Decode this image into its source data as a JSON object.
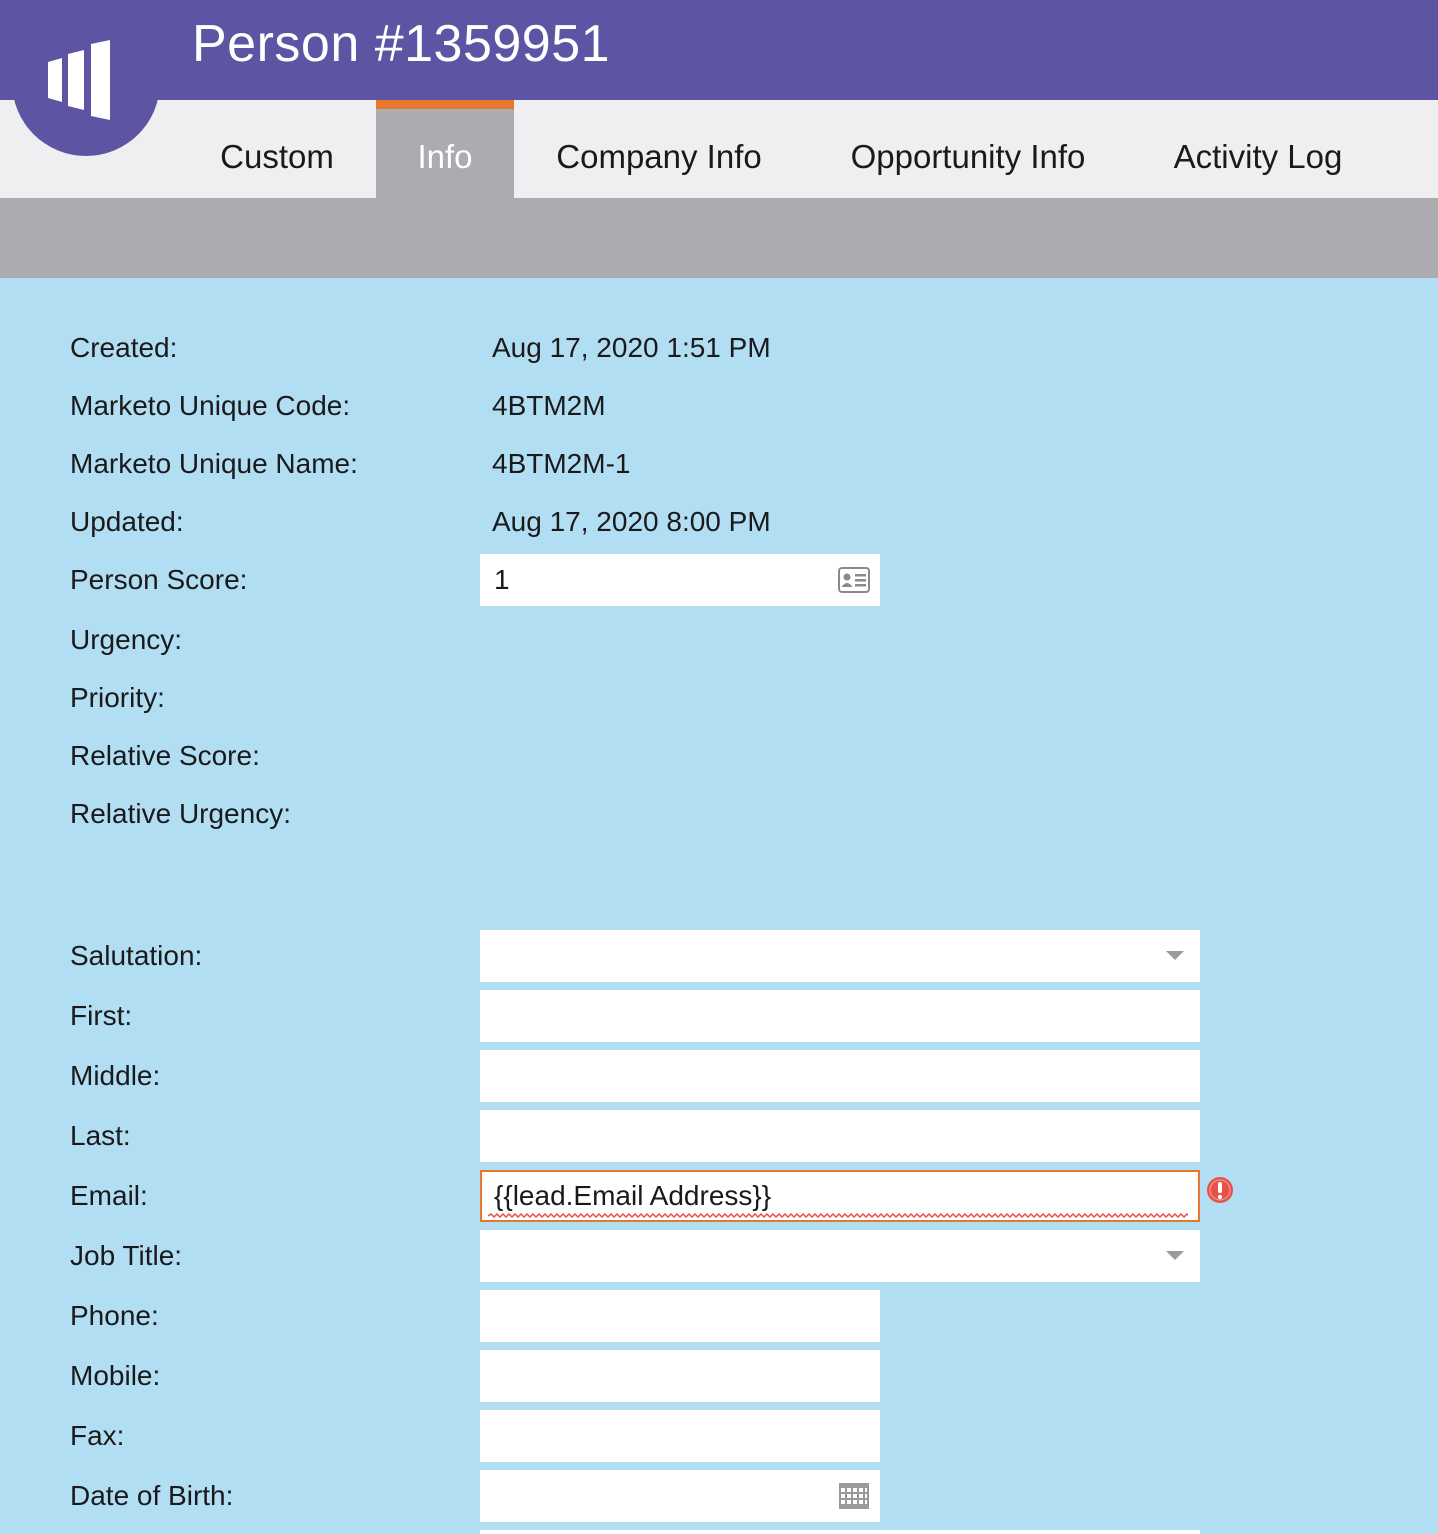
{
  "header": {
    "title": "Person #1359951"
  },
  "tabs": [
    {
      "label": "Custom",
      "active": false
    },
    {
      "label": "Info",
      "active": true
    },
    {
      "label": "Company Info",
      "active": false
    },
    {
      "label": "Opportunity Info",
      "active": false
    },
    {
      "label": "Activity Log",
      "active": false
    }
  ],
  "info": {
    "created_label": "Created:",
    "created_value": "Aug 17, 2020 1:51 PM",
    "unique_code_label": "Marketo Unique Code:",
    "unique_code_value": "4BTM2M",
    "unique_name_label": "Marketo Unique Name:",
    "unique_name_value": "4BTM2M-1",
    "updated_label": "Updated:",
    "updated_value": "Aug 17, 2020 8:00 PM",
    "person_score_label": "Person Score:",
    "person_score_value": "1",
    "urgency_label": "Urgency:",
    "priority_label": "Priority:",
    "relative_score_label": "Relative Score:",
    "relative_urgency_label": "Relative Urgency:"
  },
  "form": {
    "salutation_label": "Salutation:",
    "salutation_value": "",
    "first_label": "First:",
    "first_value": "",
    "middle_label": "Middle:",
    "middle_value": "",
    "last_label": "Last:",
    "last_value": "",
    "email_label": "Email:",
    "email_value": "{{lead.Email Address}}",
    "job_title_label": "Job Title:",
    "job_title_value": "",
    "phone_label": "Phone:",
    "phone_value": "",
    "mobile_label": "Mobile:",
    "mobile_value": "",
    "fax_label": "Fax:",
    "fax_value": "",
    "dob_label": "Date of Birth:",
    "dob_value": ""
  },
  "colors": {
    "header": "#5d55a4",
    "active_tab_accent": "#e8782b",
    "content_background": "#b2def4",
    "error": "#e8504a"
  },
  "icons": {
    "logo": "marketo-logo-icon",
    "score": "id-card-icon",
    "dropdown": "chevron-down-icon",
    "error": "exclamation-circle-icon",
    "calendar": "calendar-icon"
  }
}
